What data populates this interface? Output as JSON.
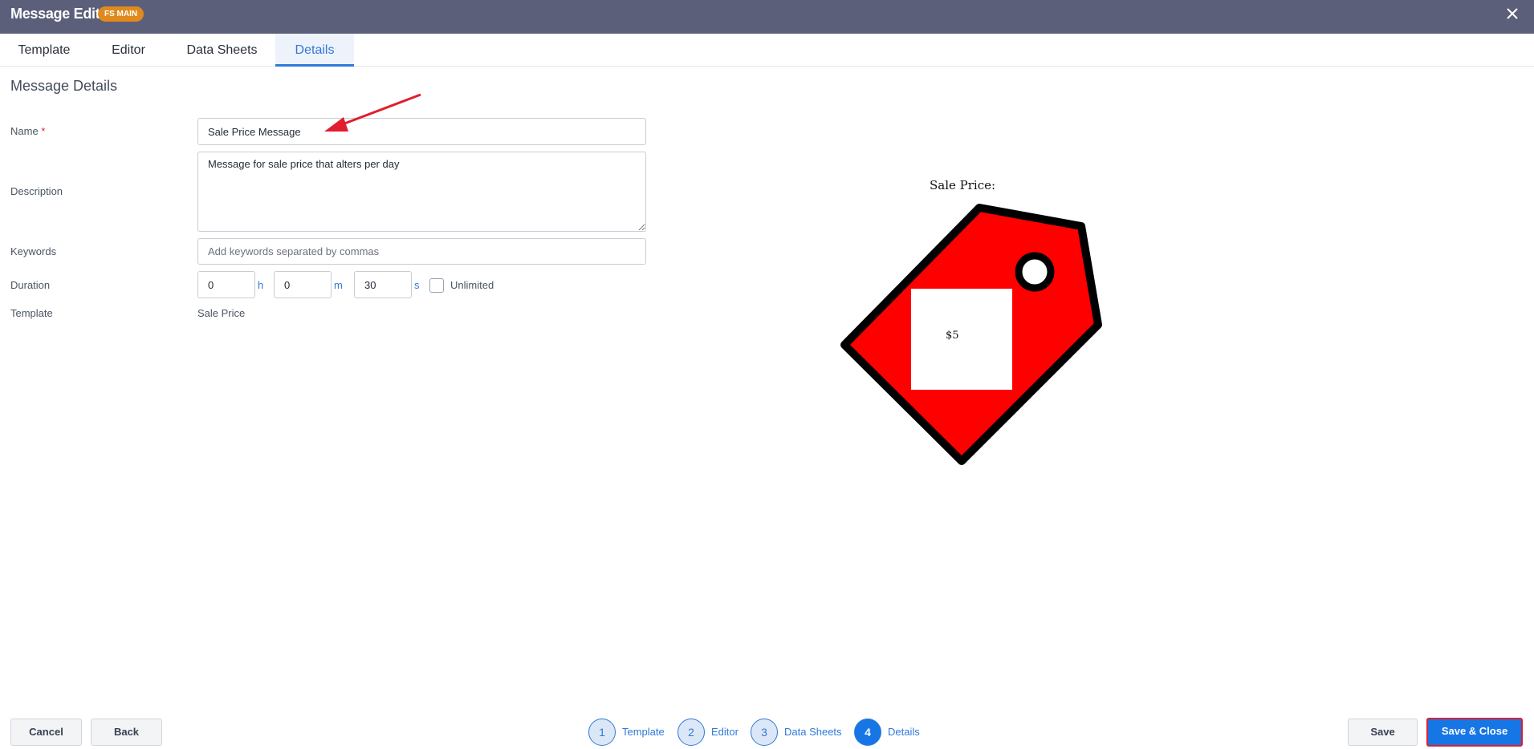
{
  "window": {
    "title": "Message Edit",
    "badge": "FS MAIN",
    "close_icon": "close-icon"
  },
  "tabs": [
    {
      "label": "Template"
    },
    {
      "label": "Editor"
    },
    {
      "label": "Data Sheets"
    },
    {
      "label": "Details",
      "active": true
    }
  ],
  "form": {
    "section_title": "Message Details",
    "name_label": "Name",
    "required_mark": "*",
    "name_value": "Sale Price Message",
    "description_label": "Description",
    "description_value": "Message for sale price that alters per day",
    "keywords_label": "Keywords",
    "keywords_placeholder": "Add keywords separated by commas",
    "duration_label": "Duration",
    "duration_hours": "0",
    "duration_hours_unit": "h",
    "duration_minutes": "0",
    "duration_minutes_unit": "m",
    "duration_seconds": "30",
    "duration_seconds_unit": "s",
    "unlimited_label": "Unlimited",
    "unlimited_checked": false,
    "template_label": "Template",
    "template_value": "Sale Price"
  },
  "preview": {
    "caption": "Sale Price:",
    "price": "$5",
    "tag_color": "#ff0000",
    "annotation_arrow_color": "#e11d2e"
  },
  "footer": {
    "cancel_label": "Cancel",
    "back_label": "Back",
    "steps": [
      {
        "number": "1",
        "label": "Template"
      },
      {
        "number": "2",
        "label": "Editor"
      },
      {
        "number": "3",
        "label": "Data Sheets"
      },
      {
        "number": "4",
        "label": "Details",
        "active": true
      }
    ],
    "save_label": "Save",
    "save_close_label": "Save & Close"
  },
  "colors": {
    "header_bg": "#5b5f7a",
    "badge_bg": "#e08a1e",
    "accent": "#1676e6"
  }
}
